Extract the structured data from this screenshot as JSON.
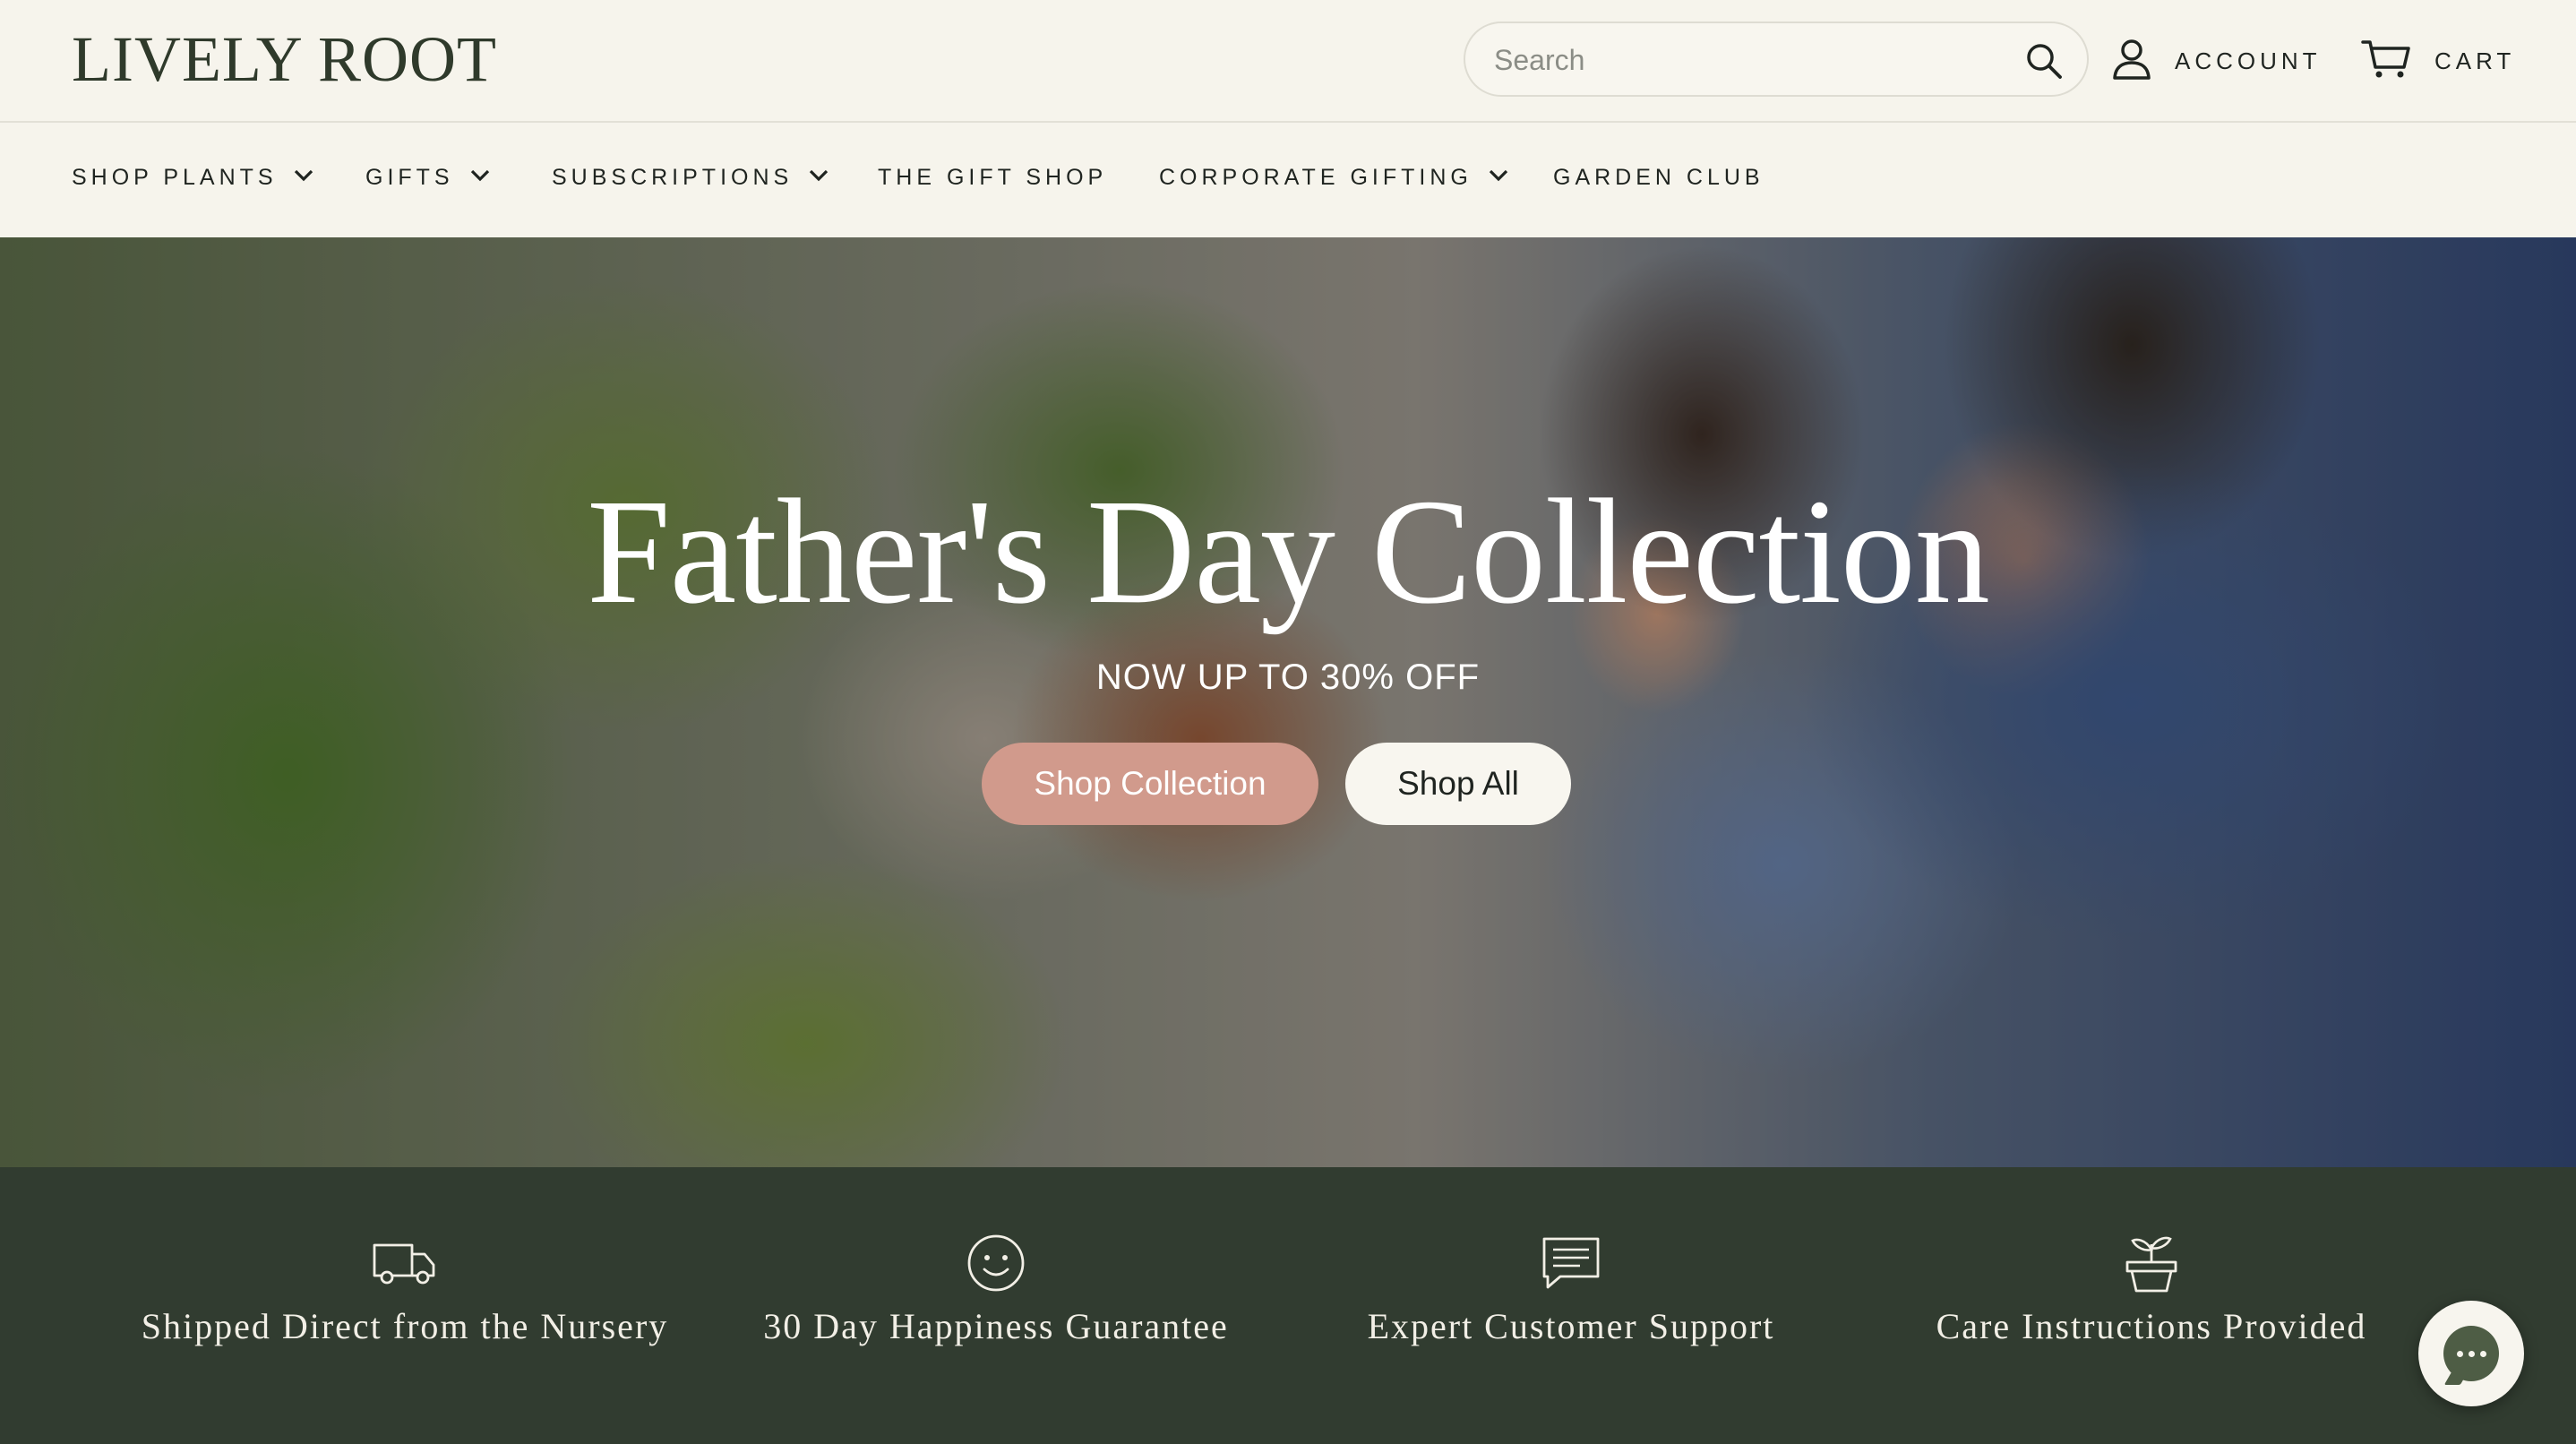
{
  "brand": {
    "logo_text": "LIVELY ROOT"
  },
  "header": {
    "search": {
      "placeholder": "Search",
      "value": ""
    },
    "account_label": "ACCOUNT",
    "cart_label": "CART"
  },
  "nav": {
    "items": [
      {
        "label": "SHOP PLANTS",
        "has_dropdown": true
      },
      {
        "label": "GIFTS",
        "has_dropdown": true
      },
      {
        "label": "SUBSCRIPTIONS",
        "has_dropdown": true
      },
      {
        "label": "THE GIFT SHOP",
        "has_dropdown": false
      },
      {
        "label": "CORPORATE GIFTING",
        "has_dropdown": true
      },
      {
        "label": "GARDEN CLUB",
        "has_dropdown": false
      }
    ]
  },
  "hero": {
    "title": "Father's Day Collection",
    "subtitle": "NOW UP TO 30% OFF",
    "primary_button": "Shop Collection",
    "secondary_button": "Shop All"
  },
  "features": [
    {
      "icon": "truck-icon",
      "text": "Shipped Direct from the Nursery"
    },
    {
      "icon": "smiley-icon",
      "text": "30 Day Happiness Guarantee"
    },
    {
      "icon": "chat-message-icon",
      "text": "Expert Customer Support"
    },
    {
      "icon": "potted-sprout-icon",
      "text": "Care Instructions Provided"
    }
  ],
  "colors": {
    "background": "#f6f4ec",
    "features_background": "#313c30",
    "primary_button": "#d19a8c",
    "chat_bubble": "#4e5d45"
  }
}
